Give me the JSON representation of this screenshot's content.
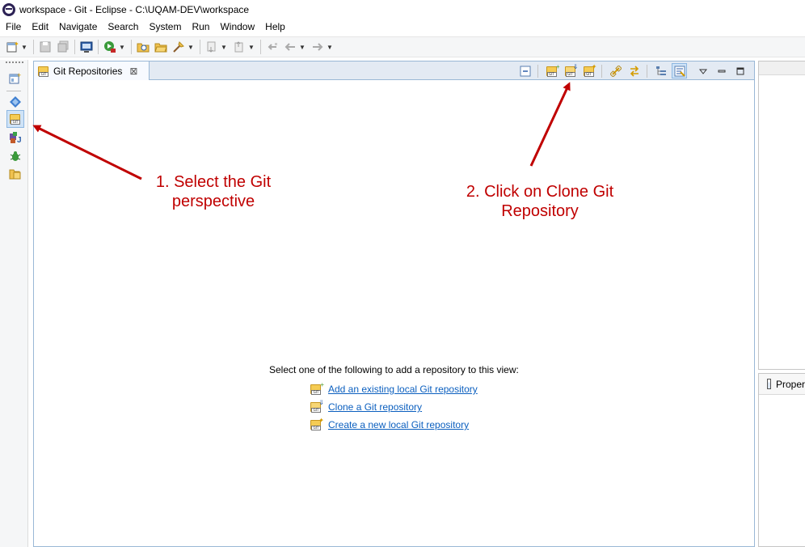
{
  "window": {
    "title": "workspace - Git - Eclipse - C:\\UQAM-DEV\\workspace",
    "icon": "eclipse-logo-icon"
  },
  "menu": [
    "File",
    "Edit",
    "Navigate",
    "Search",
    "System",
    "Run",
    "Window",
    "Help"
  ],
  "toolbar": {
    "icons": [
      "new-wizard-icon",
      "save-icon",
      "save-all-icon",
      "open-console-icon",
      "run-icon",
      "open-type-icon",
      "open-folder-icon",
      "open-task-icon",
      "next-annotation-icon",
      "previous-annotation-icon",
      "last-edit-location-icon",
      "back-icon",
      "forward-icon"
    ]
  },
  "perspectives": {
    "items": [
      "open-perspective-icon",
      "java-ee-perspective-icon",
      "git-perspective-icon",
      "java-perspective-icon",
      "debug-perspective-icon",
      "resource-perspective-icon"
    ],
    "active": "git-perspective-icon"
  },
  "view": {
    "tab_label": "Git Repositories",
    "prompt": "Select one of the following to add a repository to this view:",
    "links": [
      {
        "label": "Add an existing local Git repository"
      },
      {
        "label": "Clone a Git repository"
      },
      {
        "label": "Create a new local Git repository"
      }
    ],
    "tools": [
      "collapse-all-icon",
      "add-existing-repository-icon",
      "clone-repository-icon",
      "create-repository-icon",
      "link-with-selection-icon",
      "link-with-editor-icon",
      "hierarchical-layout-icon",
      "show-filter-icon",
      "view-menu-icon",
      "minimize-icon",
      "maximize-icon"
    ]
  },
  "right_panel": {
    "properties_label": "Proper"
  },
  "annotations": {
    "step1": [
      "1. Select the Git",
      "perspective"
    ],
    "step2": [
      "2. Click on Clone Git",
      "Repository"
    ],
    "color": "#c00000"
  },
  "colors": {
    "view_border": "#9ab8d6",
    "link": "#0b5fbf",
    "selected_bg": "#cfe3f7"
  }
}
